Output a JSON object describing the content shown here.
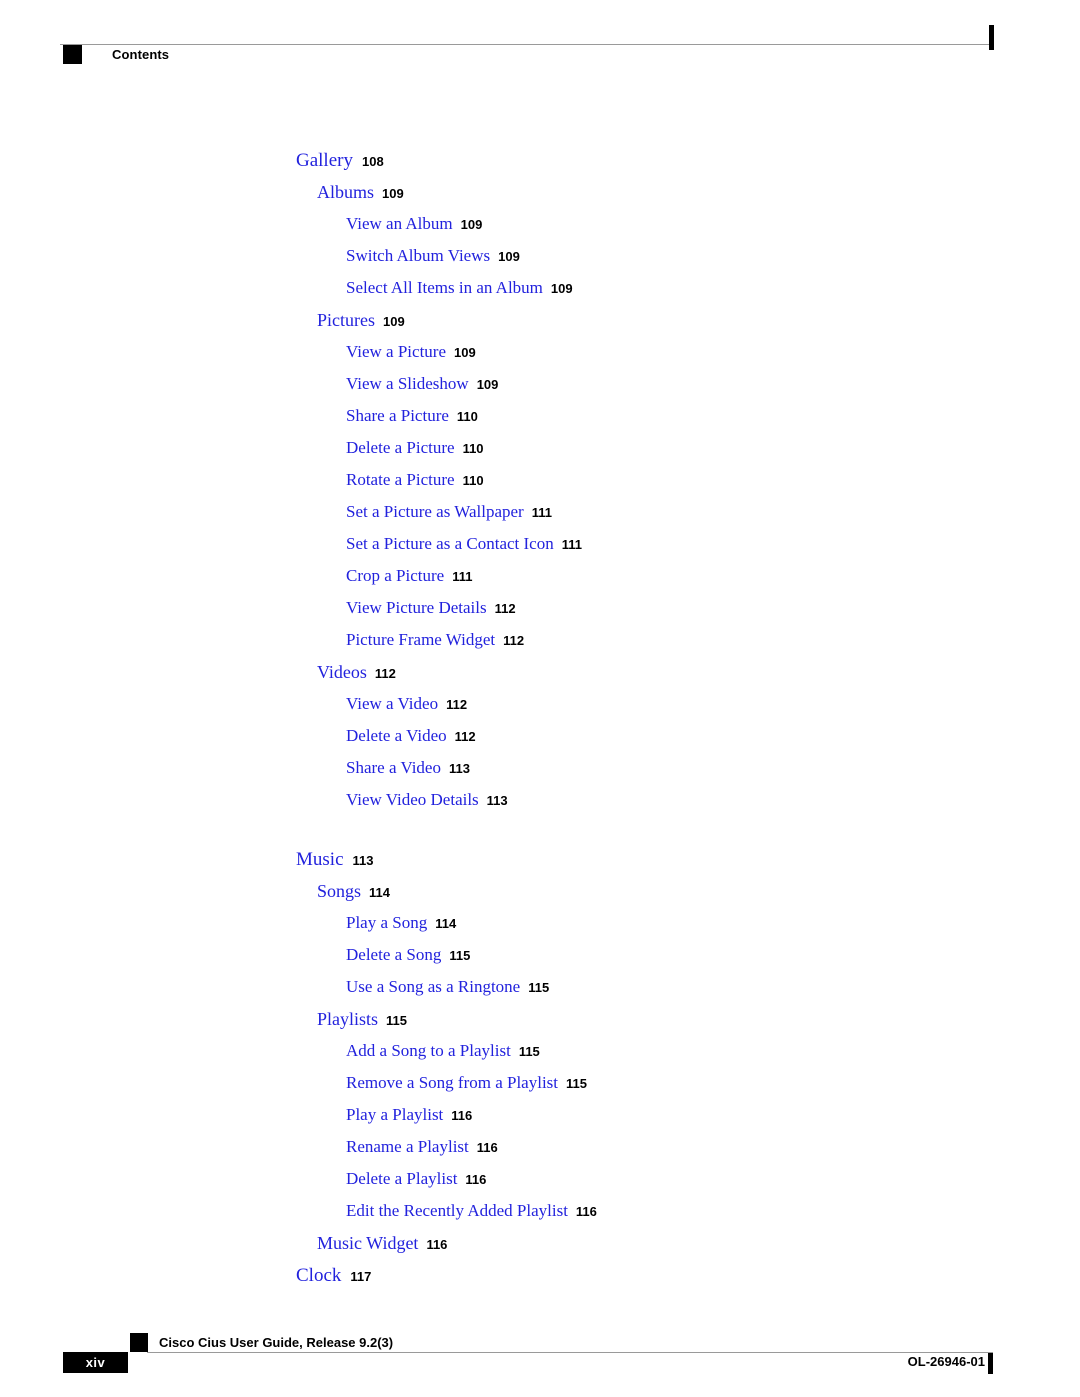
{
  "header": {
    "title": "Contents",
    "marker_icon": "black-square-marker",
    "edge_tick_icon": "change-bar-tick"
  },
  "toc": {
    "entries": [
      {
        "title": "Gallery",
        "page": "108",
        "level": 1,
        "group_start": false
      },
      {
        "title": "Albums",
        "page": "109",
        "level": 2,
        "group_start": false
      },
      {
        "title": "View an Album",
        "page": "109",
        "level": 3,
        "group_start": false
      },
      {
        "title": "Switch Album Views",
        "page": "109",
        "level": 3,
        "group_start": false
      },
      {
        "title": "Select All Items in an Album",
        "page": "109",
        "level": 3,
        "group_start": false
      },
      {
        "title": "Pictures",
        "page": "109",
        "level": 2,
        "group_start": false
      },
      {
        "title": "View a Picture",
        "page": "109",
        "level": 3,
        "group_start": false
      },
      {
        "title": "View a Slideshow",
        "page": "109",
        "level": 3,
        "group_start": false
      },
      {
        "title": "Share a Picture",
        "page": "110",
        "level": 3,
        "group_start": false
      },
      {
        "title": "Delete a Picture",
        "page": "110",
        "level": 3,
        "group_start": false
      },
      {
        "title": "Rotate a Picture",
        "page": "110",
        "level": 3,
        "group_start": false
      },
      {
        "title": "Set a Picture as Wallpaper",
        "page": "111",
        "level": 3,
        "group_start": false
      },
      {
        "title": "Set a Picture as a Contact Icon",
        "page": "111",
        "level": 3,
        "group_start": false
      },
      {
        "title": "Crop a Picture",
        "page": "111",
        "level": 3,
        "group_start": false
      },
      {
        "title": "View Picture Details",
        "page": "112",
        "level": 3,
        "group_start": false
      },
      {
        "title": "Picture Frame Widget",
        "page": "112",
        "level": 3,
        "group_start": false
      },
      {
        "title": "Videos",
        "page": "112",
        "level": 2,
        "group_start": false
      },
      {
        "title": "View a Video",
        "page": "112",
        "level": 3,
        "group_start": false
      },
      {
        "title": "Delete a Video",
        "page": "112",
        "level": 3,
        "group_start": false
      },
      {
        "title": "Share a Video",
        "page": "113",
        "level": 3,
        "group_start": false
      },
      {
        "title": "View Video Details",
        "page": "113",
        "level": 3,
        "group_start": false
      },
      {
        "title": "Music",
        "page": "113",
        "level": 1,
        "group_start": true
      },
      {
        "title": "Songs",
        "page": "114",
        "level": 2,
        "group_start": false
      },
      {
        "title": "Play a Song",
        "page": "114",
        "level": 3,
        "group_start": false
      },
      {
        "title": "Delete a Song",
        "page": "115",
        "level": 3,
        "group_start": false
      },
      {
        "title": "Use a Song as a Ringtone",
        "page": "115",
        "level": 3,
        "group_start": false
      },
      {
        "title": "Playlists",
        "page": "115",
        "level": 2,
        "group_start": false
      },
      {
        "title": "Add a Song to a Playlist",
        "page": "115",
        "level": 3,
        "group_start": false
      },
      {
        "title": "Remove a Song from a Playlist",
        "page": "115",
        "level": 3,
        "group_start": false
      },
      {
        "title": "Play a Playlist",
        "page": "116",
        "level": 3,
        "group_start": false
      },
      {
        "title": "Rename a Playlist",
        "page": "116",
        "level": 3,
        "group_start": false
      },
      {
        "title": "Delete a Playlist",
        "page": "116",
        "level": 3,
        "group_start": false
      },
      {
        "title": "Edit the Recently Added Playlist",
        "page": "116",
        "level": 3,
        "group_start": false
      },
      {
        "title": "Music Widget",
        "page": "116",
        "level": 2,
        "group_start": false
      },
      {
        "title": "Clock",
        "page": "117",
        "level": 1,
        "group_start": false
      }
    ]
  },
  "footer": {
    "guide_title": "Cisco Cius User Guide, Release 9.2(3)",
    "folio": "xiv",
    "doc_id": "OL-26946-01",
    "marker_icon": "black-square-marker",
    "edge_tick_icon": "change-bar-tick"
  },
  "colors": {
    "link_blue": "#2222dd",
    "rule_gray": "#9a9a9a",
    "marker_black": "#000000"
  }
}
